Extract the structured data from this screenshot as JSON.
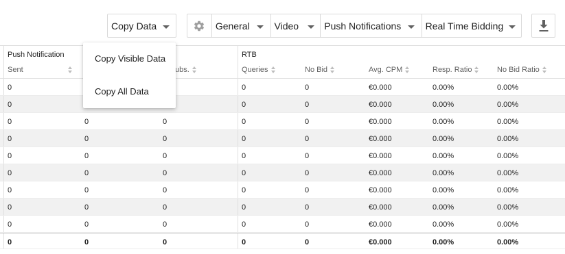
{
  "toolbar": {
    "copy_data": "Copy Data",
    "dropdowns": [
      "General",
      "Video",
      "Push Notifications",
      "Real Time Bidding"
    ],
    "icons": {
      "settings": "gear-icon",
      "download": "download-icon",
      "caret": "chevron-down-icon"
    }
  },
  "menu": {
    "items": [
      "Copy Visible Data",
      "Copy All Data"
    ]
  },
  "table": {
    "groups": {
      "push": "Push Notification",
      "rtb": "RTB"
    },
    "columns": {
      "sent": "Sent",
      "subs": "ubs.",
      "queries": "Queries",
      "no_bid": "No Bid",
      "avg_cpm": "Avg. CPM",
      "resp_ratio": "Resp. Ratio",
      "no_bid_ratio": "No Bid Ratio"
    },
    "rows": [
      [
        "0",
        "",
        "",
        "0",
        "0",
        "€0.000",
        "0.00%",
        "0.00%"
      ],
      [
        "0",
        "",
        "",
        "0",
        "0",
        "€0.000",
        "0.00%",
        "0.00%"
      ],
      [
        "0",
        "0",
        "0",
        "0",
        "0",
        "€0.000",
        "0.00%",
        "0.00%"
      ],
      [
        "0",
        "0",
        "0",
        "0",
        "0",
        "€0.000",
        "0.00%",
        "0.00%"
      ],
      [
        "0",
        "0",
        "0",
        "0",
        "0",
        "€0.000",
        "0.00%",
        "0.00%"
      ],
      [
        "0",
        "0",
        "0",
        "0",
        "0",
        "€0.000",
        "0.00%",
        "0.00%"
      ],
      [
        "0",
        "0",
        "0",
        "0",
        "0",
        "€0.000",
        "0.00%",
        "0.00%"
      ],
      [
        "0",
        "0",
        "0",
        "0",
        "0",
        "€0.000",
        "0.00%",
        "0.00%"
      ],
      [
        "0",
        "0",
        "0",
        "0",
        "0",
        "€0.000",
        "0.00%",
        "0.00%"
      ]
    ],
    "total": [
      "0",
      "0",
      "0",
      "0",
      "0",
      "€0.000",
      "0.00%",
      "0.00%"
    ]
  },
  "colors": {
    "border": "#d9d9d9",
    "stripe": "#f1f1f1",
    "text": "#212121",
    "muted": "#616161",
    "sort_arrow": "#bdbdbd"
  }
}
